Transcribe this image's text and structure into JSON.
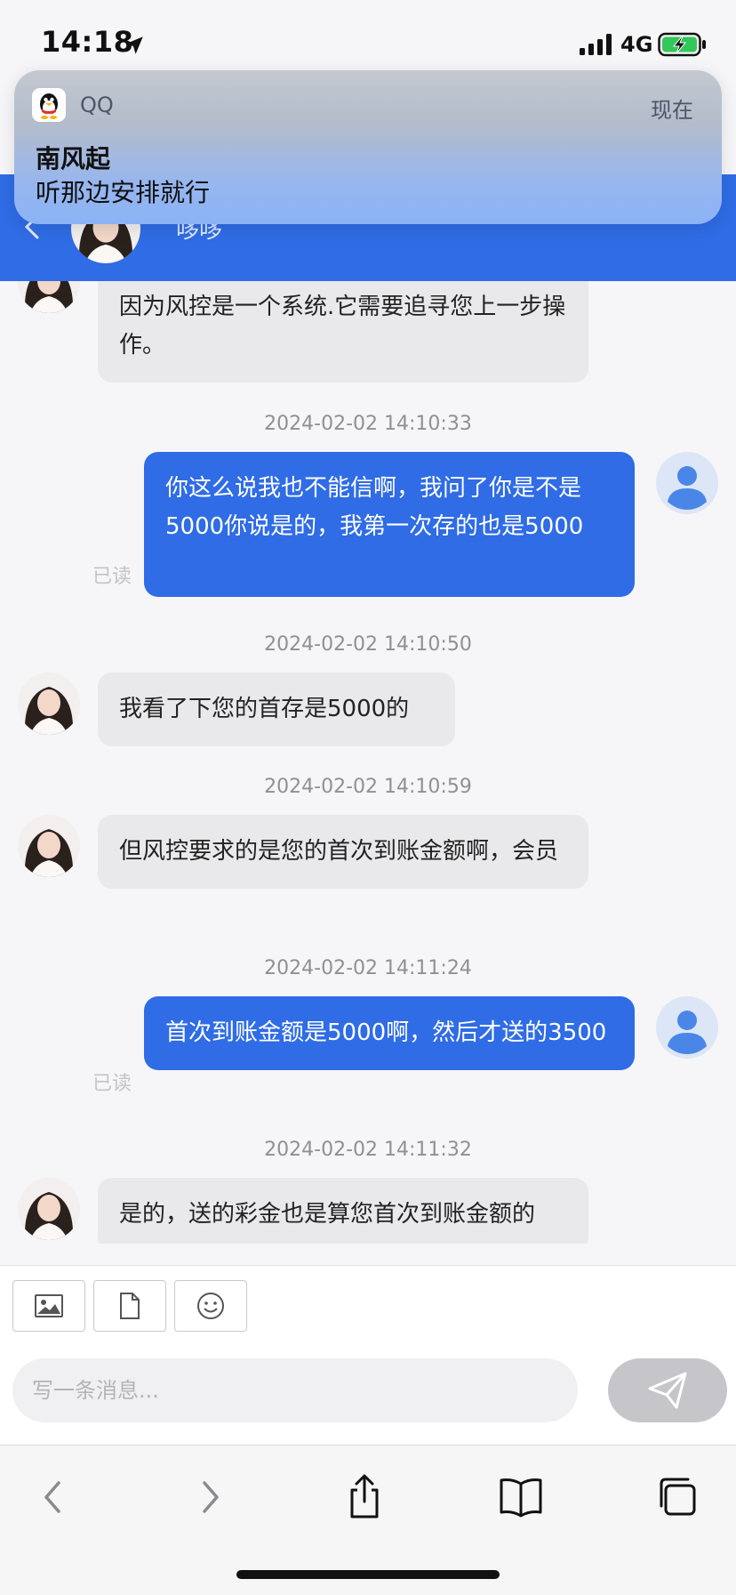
{
  "status_bar": {
    "time": "14:18",
    "network": "4G"
  },
  "header": {
    "contact_name": "哆哆"
  },
  "notification": {
    "app": "QQ",
    "time": "现在",
    "title": "南风起",
    "body": "听那边安排就行"
  },
  "messages": [
    {
      "side": "in",
      "text": "因为风控是一个系统.它需要追寻您上一步操作。"
    },
    {
      "timestamp": "2024-02-02 14:10:33",
      "side": "out",
      "text": "你这么说我也不能信啊，我问了你是不是5000你说是的，我第一次存的也是5000",
      "status": "已读"
    },
    {
      "timestamp": "2024-02-02 14:10:50",
      "side": "in",
      "text": "我看了下您的首存是5000的"
    },
    {
      "timestamp": "2024-02-02 14:10:59",
      "side": "in",
      "text": "但风控要求的是您的首次到账金额啊，会员"
    },
    {
      "timestamp": "2024-02-02 14:11:24",
      "side": "out",
      "text": "首次到账金额是5000啊，然后才送的3500",
      "status": "已读"
    },
    {
      "timestamp": "2024-02-02 14:11:32",
      "side": "in",
      "text": "是的，送的彩金也是算您首次到账金额的"
    }
  ],
  "composer": {
    "placeholder": "写一条消息..."
  },
  "icons": {
    "back": "chevron-left-icon",
    "speaker": "speaker-icon",
    "image": "image-icon",
    "file": "file-icon",
    "emoji": "emoji-icon",
    "send": "send-icon",
    "share": "share-icon",
    "bookmarks": "book-icon",
    "tabs": "tabs-icon"
  },
  "colors": {
    "accent": "#2f6ce5",
    "incoming_bubble": "#e9e9eb",
    "timestamp": "#8f8f96",
    "read": "#c4c4c8",
    "battery": "#34c759"
  }
}
